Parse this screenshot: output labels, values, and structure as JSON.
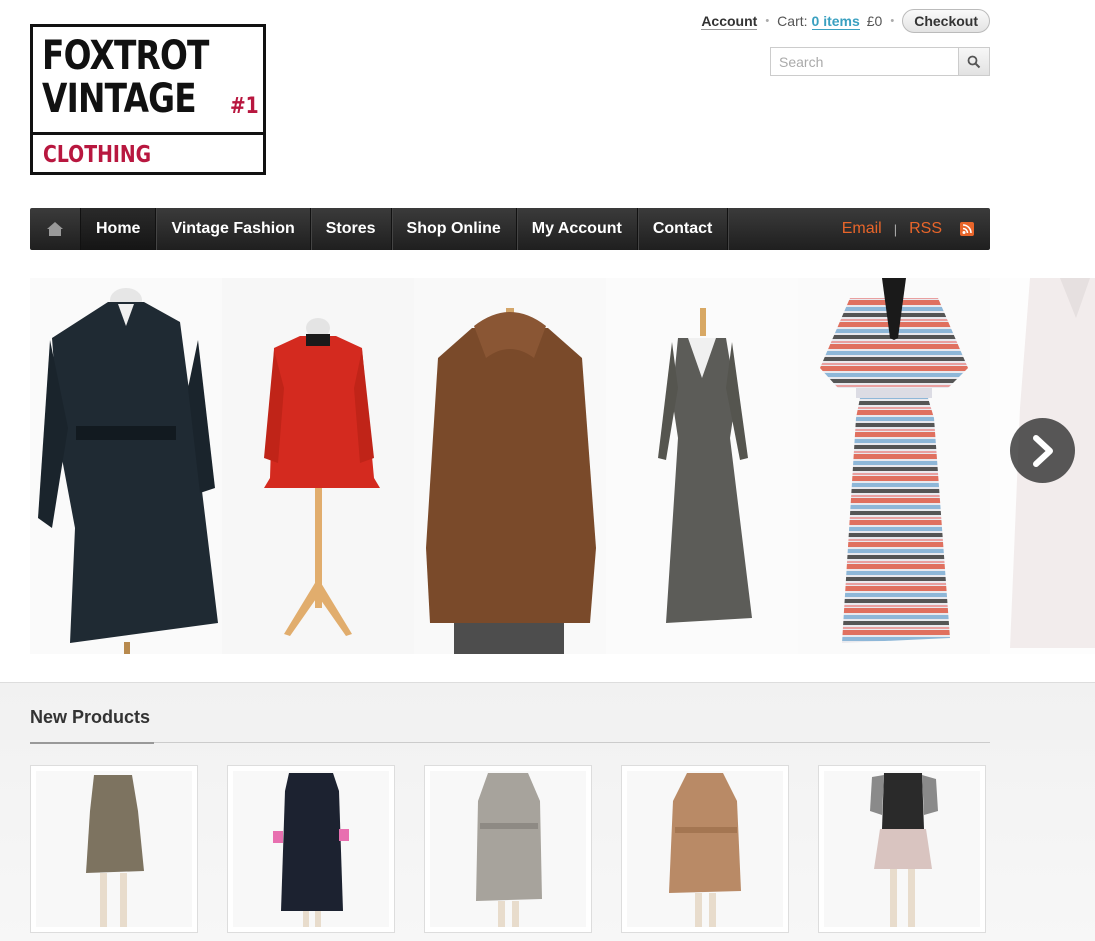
{
  "logo": {
    "line1": "FOXTROT",
    "line2": "VINTAGE",
    "number": "#1",
    "line3": "CLOTHING"
  },
  "header": {
    "account_label": "Account",
    "cart_label": "Cart:",
    "cart_items": "0 items",
    "cart_total": "£0",
    "checkout_label": "Checkout",
    "search_placeholder": "Search"
  },
  "nav": {
    "items": [
      {
        "label": "Home",
        "active": true
      },
      {
        "label": "Vintage Fashion",
        "active": false
      },
      {
        "label": "Stores",
        "active": false
      },
      {
        "label": "Shop Online",
        "active": false
      },
      {
        "label": "My Account",
        "active": false
      },
      {
        "label": "Contact",
        "active": false
      }
    ],
    "email_label": "Email",
    "rss_label": "RSS"
  },
  "carousel": {
    "slides": [
      {
        "depicts": "navy trench coat",
        "color": "#1f2a33"
      },
      {
        "depicts": "red military jacket",
        "color": "#d42a1f"
      },
      {
        "depicts": "brown fur coat",
        "color": "#7a4a2a"
      },
      {
        "depicts": "grey maxi dress",
        "color": "#5c5c58"
      },
      {
        "depicts": "striped dress",
        "color": "#c8c8d8"
      },
      {
        "depicts": "white lace dress",
        "color": "#f2ecec"
      }
    ]
  },
  "products": {
    "title": "New Products",
    "items": [
      {
        "depicts": "plaid dress",
        "color": "#7d7360"
      },
      {
        "depicts": "navy coat with pink cuffs",
        "color": "#1c2230"
      },
      {
        "depicts": "grey check coat",
        "color": "#a7a39c"
      },
      {
        "depicts": "camel trench coat",
        "color": "#b98a66"
      },
      {
        "depicts": "black vest with pink skirt",
        "color": "#2a2a2a"
      }
    ]
  },
  "colors": {
    "accent_orange": "#e8652a",
    "brand_red": "#b8173f",
    "link_blue": "#3aa0c0"
  }
}
